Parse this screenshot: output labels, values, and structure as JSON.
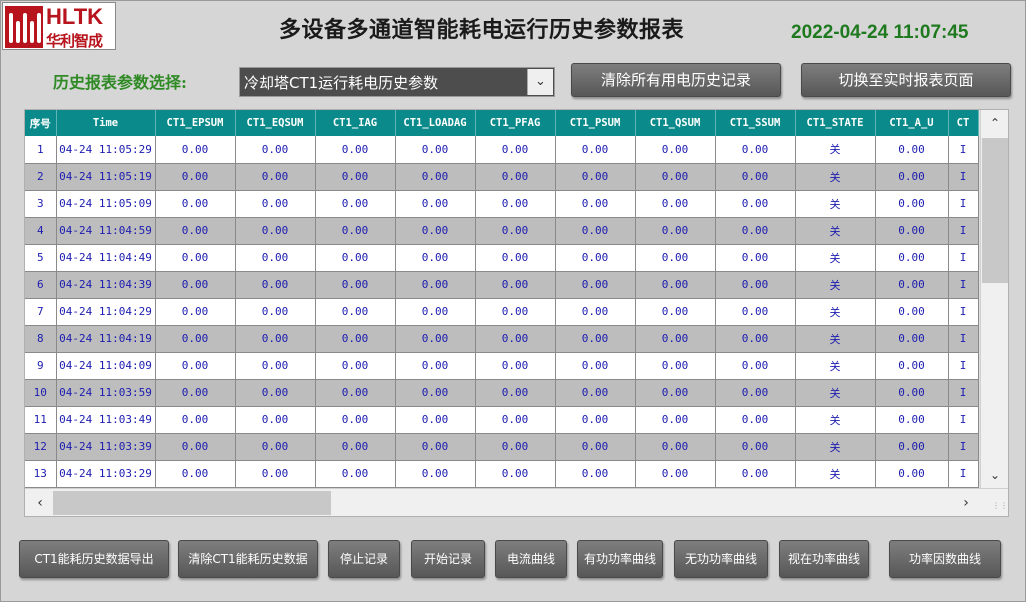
{
  "logo": {
    "brand": "HLTK",
    "brand_cn": "华利智成"
  },
  "header": {
    "title": "多设备多通道智能耗电运行历史参数报表",
    "clock": "2022-04-24 11:07:45"
  },
  "selector": {
    "label": "历史报表参数选择:",
    "value": "冷却塔CT1运行耗电历史参数"
  },
  "top_buttons": {
    "clear_history": "清除所有用电历史记录",
    "switch_realtime": "切换至实时报表页面"
  },
  "table": {
    "columns": [
      "序号",
      "Time",
      "CT1_EPSUM",
      "CT1_EQSUM",
      "CT1_IAG",
      "CT1_LOADAG",
      "CT1_PFAG",
      "CT1_PSUM",
      "CT1_QSUM",
      "CT1_SSUM",
      "CT1_STATE",
      "CT1_A_U",
      "CT"
    ],
    "rows": [
      [
        "1",
        "04-24 11:05:29",
        "0.00",
        "0.00",
        "0.00",
        "0.00",
        "0.00",
        "0.00",
        "0.00",
        "0.00",
        "关",
        "0.00"
      ],
      [
        "2",
        "04-24 11:05:19",
        "0.00",
        "0.00",
        "0.00",
        "0.00",
        "0.00",
        "0.00",
        "0.00",
        "0.00",
        "关",
        "0.00"
      ],
      [
        "3",
        "04-24 11:05:09",
        "0.00",
        "0.00",
        "0.00",
        "0.00",
        "0.00",
        "0.00",
        "0.00",
        "0.00",
        "关",
        "0.00"
      ],
      [
        "4",
        "04-24 11:04:59",
        "0.00",
        "0.00",
        "0.00",
        "0.00",
        "0.00",
        "0.00",
        "0.00",
        "0.00",
        "关",
        "0.00"
      ],
      [
        "5",
        "04-24 11:04:49",
        "0.00",
        "0.00",
        "0.00",
        "0.00",
        "0.00",
        "0.00",
        "0.00",
        "0.00",
        "关",
        "0.00"
      ],
      [
        "6",
        "04-24 11:04:39",
        "0.00",
        "0.00",
        "0.00",
        "0.00",
        "0.00",
        "0.00",
        "0.00",
        "0.00",
        "关",
        "0.00"
      ],
      [
        "7",
        "04-24 11:04:29",
        "0.00",
        "0.00",
        "0.00",
        "0.00",
        "0.00",
        "0.00",
        "0.00",
        "0.00",
        "关",
        "0.00"
      ],
      [
        "8",
        "04-24 11:04:19",
        "0.00",
        "0.00",
        "0.00",
        "0.00",
        "0.00",
        "0.00",
        "0.00",
        "0.00",
        "关",
        "0.00"
      ],
      [
        "9",
        "04-24 11:04:09",
        "0.00",
        "0.00",
        "0.00",
        "0.00",
        "0.00",
        "0.00",
        "0.00",
        "0.00",
        "关",
        "0.00"
      ],
      [
        "10",
        "04-24 11:03:59",
        "0.00",
        "0.00",
        "0.00",
        "0.00",
        "0.00",
        "0.00",
        "0.00",
        "0.00",
        "关",
        "0.00"
      ],
      [
        "11",
        "04-24 11:03:49",
        "0.00",
        "0.00",
        "0.00",
        "0.00",
        "0.00",
        "0.00",
        "0.00",
        "0.00",
        "关",
        "0.00"
      ],
      [
        "12",
        "04-24 11:03:39",
        "0.00",
        "0.00",
        "0.00",
        "0.00",
        "0.00",
        "0.00",
        "0.00",
        "0.00",
        "关",
        "0.00"
      ],
      [
        "13",
        "04-24 11:03:29",
        "0.00",
        "0.00",
        "0.00",
        "0.00",
        "0.00",
        "0.00",
        "0.00",
        "0.00",
        "关",
        "0.00"
      ],
      [
        "",
        "",
        "",
        "",
        "",
        "",
        "",
        "",
        "",
        "",
        "",
        ""
      ]
    ]
  },
  "bottom_buttons": [
    "CT1能耗历史数据导出",
    "清除CT1能耗历史数据",
    "停止记录",
    "开始记录",
    "电流曲线",
    "有功功率曲线",
    "无功功率曲线",
    "视在功率曲线",
    "功率因数曲线"
  ],
  "colors": {
    "header_teal": "#0a8a8a",
    "clock_green": "#1f7a1f",
    "label_green": "#2f8a25",
    "brand_red": "#b8141d",
    "cell_blue": "#1c1cb0"
  },
  "icons": {
    "select_arrow": "chevron-down-icon",
    "scroll_up": "chevron-up-icon",
    "scroll_down": "chevron-down-icon",
    "scroll_left": "chevron-left-icon",
    "scroll_right": "chevron-right-icon"
  }
}
